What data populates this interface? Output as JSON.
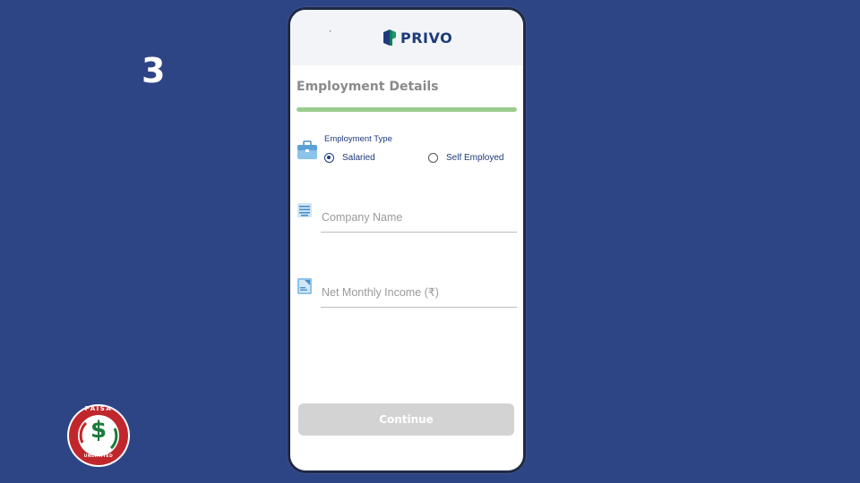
{
  "slide": {
    "step_number": "3"
  },
  "app": {
    "header_tick": "'",
    "brand_name": "PRIVO",
    "section_title": "Employment Details",
    "progress_percent": 100,
    "employment_type": {
      "label": "Employment Type",
      "options": [
        {
          "label": "Salaried",
          "selected": true
        },
        {
          "label": "Self Employed",
          "selected": false
        }
      ]
    },
    "company_name": {
      "value": "",
      "placeholder": "Company Name"
    },
    "net_monthly_income": {
      "value": "",
      "placeholder": "Net Monthly Income (₹)"
    },
    "continue_label": "Continue"
  },
  "badge": {
    "top_text": "PAISA",
    "symbol": "$",
    "bottom_text": "UNLIMITED"
  },
  "colors": {
    "background": "#2e4585",
    "brand_blue": "#1d3a7a",
    "brand_green": "#1a9a6c",
    "progress_green": "#9ccb8e",
    "button_disabled": "#d3d3d3",
    "badge_red": "#c0272d"
  },
  "icons": {
    "employment_type": "briefcase-icon",
    "company_name": "building-icon",
    "net_monthly_income": "document-icon"
  }
}
